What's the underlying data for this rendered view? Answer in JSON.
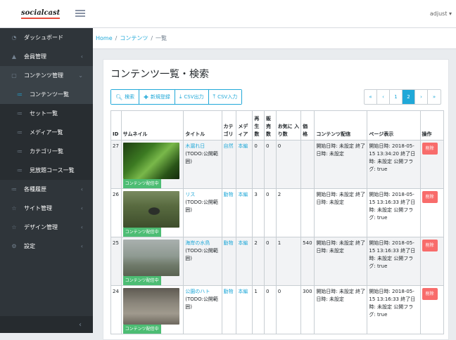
{
  "app": {
    "logo": "socialcast",
    "user": "adjust ▾"
  },
  "sidebar": {
    "items": [
      {
        "icon": "◔",
        "icon_name": "speedometer-icon",
        "label": "ダッシュボード",
        "chev": ""
      },
      {
        "icon": "▲",
        "icon_name": "people-icon",
        "label": "会員管理",
        "chev": "‹"
      },
      {
        "icon": "▢",
        "icon_name": "contents-icon",
        "label": "コンテンツ管理",
        "chev": "⌄"
      },
      {
        "icon": "≔",
        "icon_name": "list-icon",
        "label": "コンテンツ一覧",
        "chev": ""
      },
      {
        "icon": "≔",
        "icon_name": "list-icon",
        "label": "セット一覧",
        "chev": ""
      },
      {
        "icon": "≔",
        "icon_name": "list-icon",
        "label": "メディア一覧",
        "chev": ""
      },
      {
        "icon": "≔",
        "icon_name": "list-icon",
        "label": "カテゴリ一覧",
        "chev": ""
      },
      {
        "icon": "≔",
        "icon_name": "list-icon",
        "label": "見放題コース一覧",
        "chev": ""
      },
      {
        "icon": "≔",
        "icon_name": "history-icon",
        "label": "各種履歴",
        "chev": "‹"
      },
      {
        "icon": "☆",
        "icon_name": "star-icon",
        "label": "サイト管理",
        "chev": "‹"
      },
      {
        "icon": "☆",
        "icon_name": "star-icon",
        "label": "デザイン管理",
        "chev": "‹"
      },
      {
        "icon": "⚙",
        "icon_name": "gear-icon",
        "label": "設定",
        "chev": "‹"
      }
    ],
    "minimizer": "‹"
  },
  "breadcrumb": {
    "home": "Home",
    "sep1": "/",
    "contents": "コンテンツ",
    "sep2": "/",
    "current": "一覧"
  },
  "page": {
    "title": "コンテンツ一覧・検索"
  },
  "toolbar": {
    "search": "検索",
    "new": "新規登録",
    "csv_out": "CSV出力",
    "csv_in": "CSV入力"
  },
  "pagination": {
    "first": "«",
    "prev": "‹",
    "p1": "1",
    "p2": "2",
    "next": "›",
    "last": "»"
  },
  "table": {
    "headers": {
      "id": "ID",
      "thumb": "サムネイル",
      "title": "タイトル",
      "category": "カテ ゴリ",
      "media": "メデ ィア",
      "plays": "再 生 数",
      "sales": "販 売 数",
      "favorites": "お気に 入り数",
      "price": "価 格",
      "delivery": "コンテンツ配信",
      "page": "ページ表示",
      "ops": "操作"
    },
    "rows": [
      {
        "id": "27",
        "badge": "コンテンツ配信中",
        "title": "木漏れ日",
        "title_note": "(TODO:公開範囲)",
        "category": "自然",
        "media": "本編",
        "plays": "0",
        "sales": "0",
        "favorites": "0",
        "price": "",
        "delivery": "開始日時: 未設定 終了日時: 未設定",
        "page": "開始日時: 2018-05-15 13:34:20 終了日時: 未設定 公開フラグ: true",
        "delete": "削除"
      },
      {
        "id": "26",
        "badge": "コンテンツ配信中",
        "title": "リス",
        "title_note": "(TODO:公開範囲)",
        "category": "動物",
        "media": "本編",
        "plays": "3",
        "sales": "0",
        "favorites": "2",
        "price": "",
        "delivery": "開始日時: 未設定 終了日時: 未設定",
        "page": "開始日時: 2018-05-15 13:16:33 終了日時: 未設定 公開フラグ: true",
        "delete": "削除"
      },
      {
        "id": "25",
        "badge": "コンテンツ配信中",
        "title": "海岸の水鳥",
        "title_note": "(TODO:公開範囲)",
        "category": "動物",
        "media": "本編",
        "plays": "2",
        "sales": "0",
        "favorites": "1",
        "price": "540",
        "delivery": "開始日時: 未設定 終了日時: 未設定",
        "page": "開始日時: 2018-05-15 13:16:33 終了日時: 未設定 公開フラグ: true",
        "delete": "削除"
      },
      {
        "id": "24",
        "badge": "コンテンツ配信中",
        "title": "公園のハト",
        "title_note": "(TODO:公開範囲)",
        "category": "動物",
        "media": "本編",
        "plays": "1",
        "sales": "0",
        "favorites": "0",
        "price": "300",
        "delivery": "開始日時: 未設定 終了日時: 未設定",
        "page": "開始日時: 2018-05-15 13:16:33 終了日時: 未設定 公開フラグ: true",
        "delete": "削除"
      }
    ]
  },
  "colors": {
    "accent": "#20a8d8",
    "sidebar": "#2f353a",
    "danger": "#f86c6b",
    "success": "#4dbd74"
  }
}
